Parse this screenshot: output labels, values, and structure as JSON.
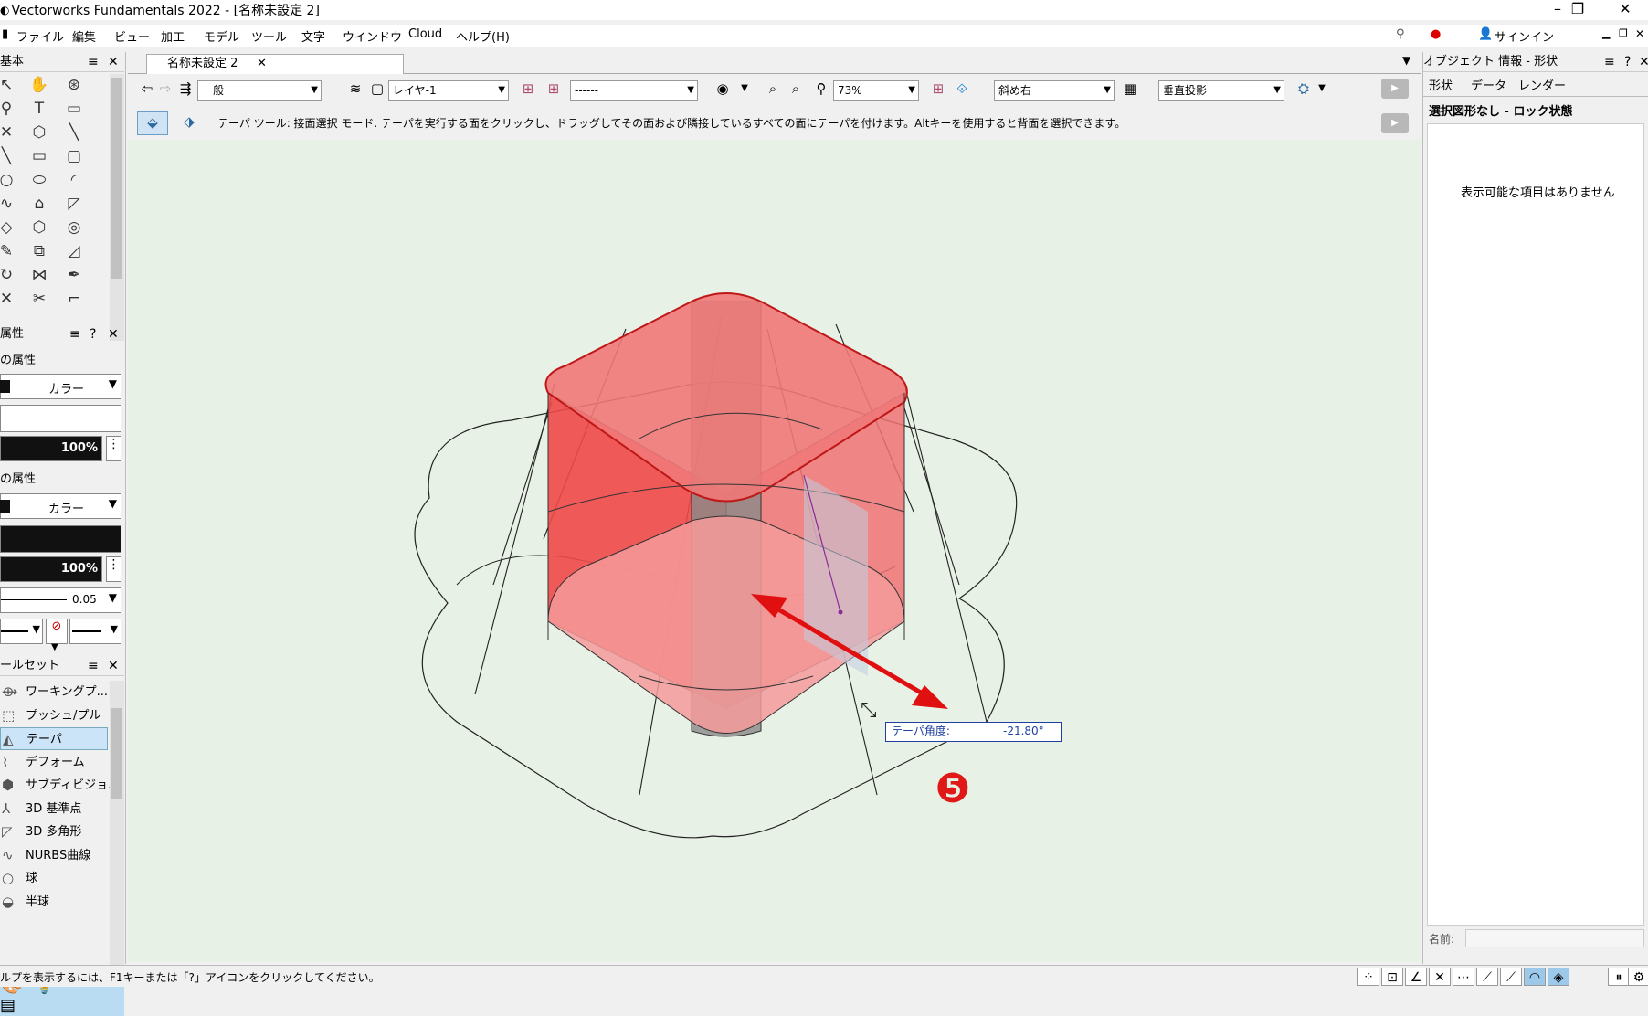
{
  "window": {
    "title": "Vectorworks Fundamentals 2022 - [名称未設定 2]",
    "controls": [
      "–",
      "❐",
      "✕"
    ]
  },
  "menu": {
    "items": [
      "ファイル",
      "編集",
      "ビュー",
      "モデル",
      "加工",
      "ツール",
      "文字",
      "ウインドウ",
      "Cloud",
      "ヘルプ(H)"
    ],
    "signin": "サインイン"
  },
  "document": {
    "tab_label": "名称未設定 2",
    "tab_close": "✕"
  },
  "viewbar": {
    "class_value": "一般",
    "layer_value": "レイヤ-1",
    "saved_view_value": "------",
    "zoom_value": "73%",
    "view_value": "斜め右",
    "projection_value": "垂直投影"
  },
  "modebar": {
    "hint": "テーパ ツール: 接面選択 モード. テーパを実行する面をクリックし、ドラッグしてその面および隣接しているすべての面にテーパを付けます。Altキーを使用すると背面を選択できます。"
  },
  "left": {
    "basic_title": "基本",
    "attr_title": "属性",
    "fill_label": "の属性",
    "fill_value": "カラー",
    "fill_opacity": "100%",
    "pen_label": "の属性",
    "pen_value": "カラー",
    "pen_opacity": "100%",
    "line_weight": "0.05",
    "toolset_title": "ールセット",
    "toolset_items": [
      "ワーキングプ...",
      "プッシュ/プル",
      "テーパ",
      "デフォーム",
      "サブディビジョ...",
      "3D 基準点",
      "3D 多角形",
      "NURBS曲線",
      "球",
      "半球"
    ],
    "selected_tool_index": 2
  },
  "right": {
    "title": "オブジェクト 情報 - 形状",
    "tabs": [
      "形状",
      "データ",
      "レンダー"
    ],
    "status": "選択図形なし - ロック状態",
    "empty_message": "表示可能な項目はありません",
    "name_label": "名前:"
  },
  "canvas": {
    "data_display_label": "テーパ角度:",
    "data_display_value": "-21.80°",
    "step_marker": "❺",
    "colors": {
      "background": "#e8f1e6",
      "selection_red": "#f04040",
      "annotation_arrow": "#e01010",
      "data_box_border": "#2040a0"
    }
  },
  "statusbar": {
    "text": "ルプを表示するには、F1キーまたは「?」アイコンをクリックしてください。"
  }
}
